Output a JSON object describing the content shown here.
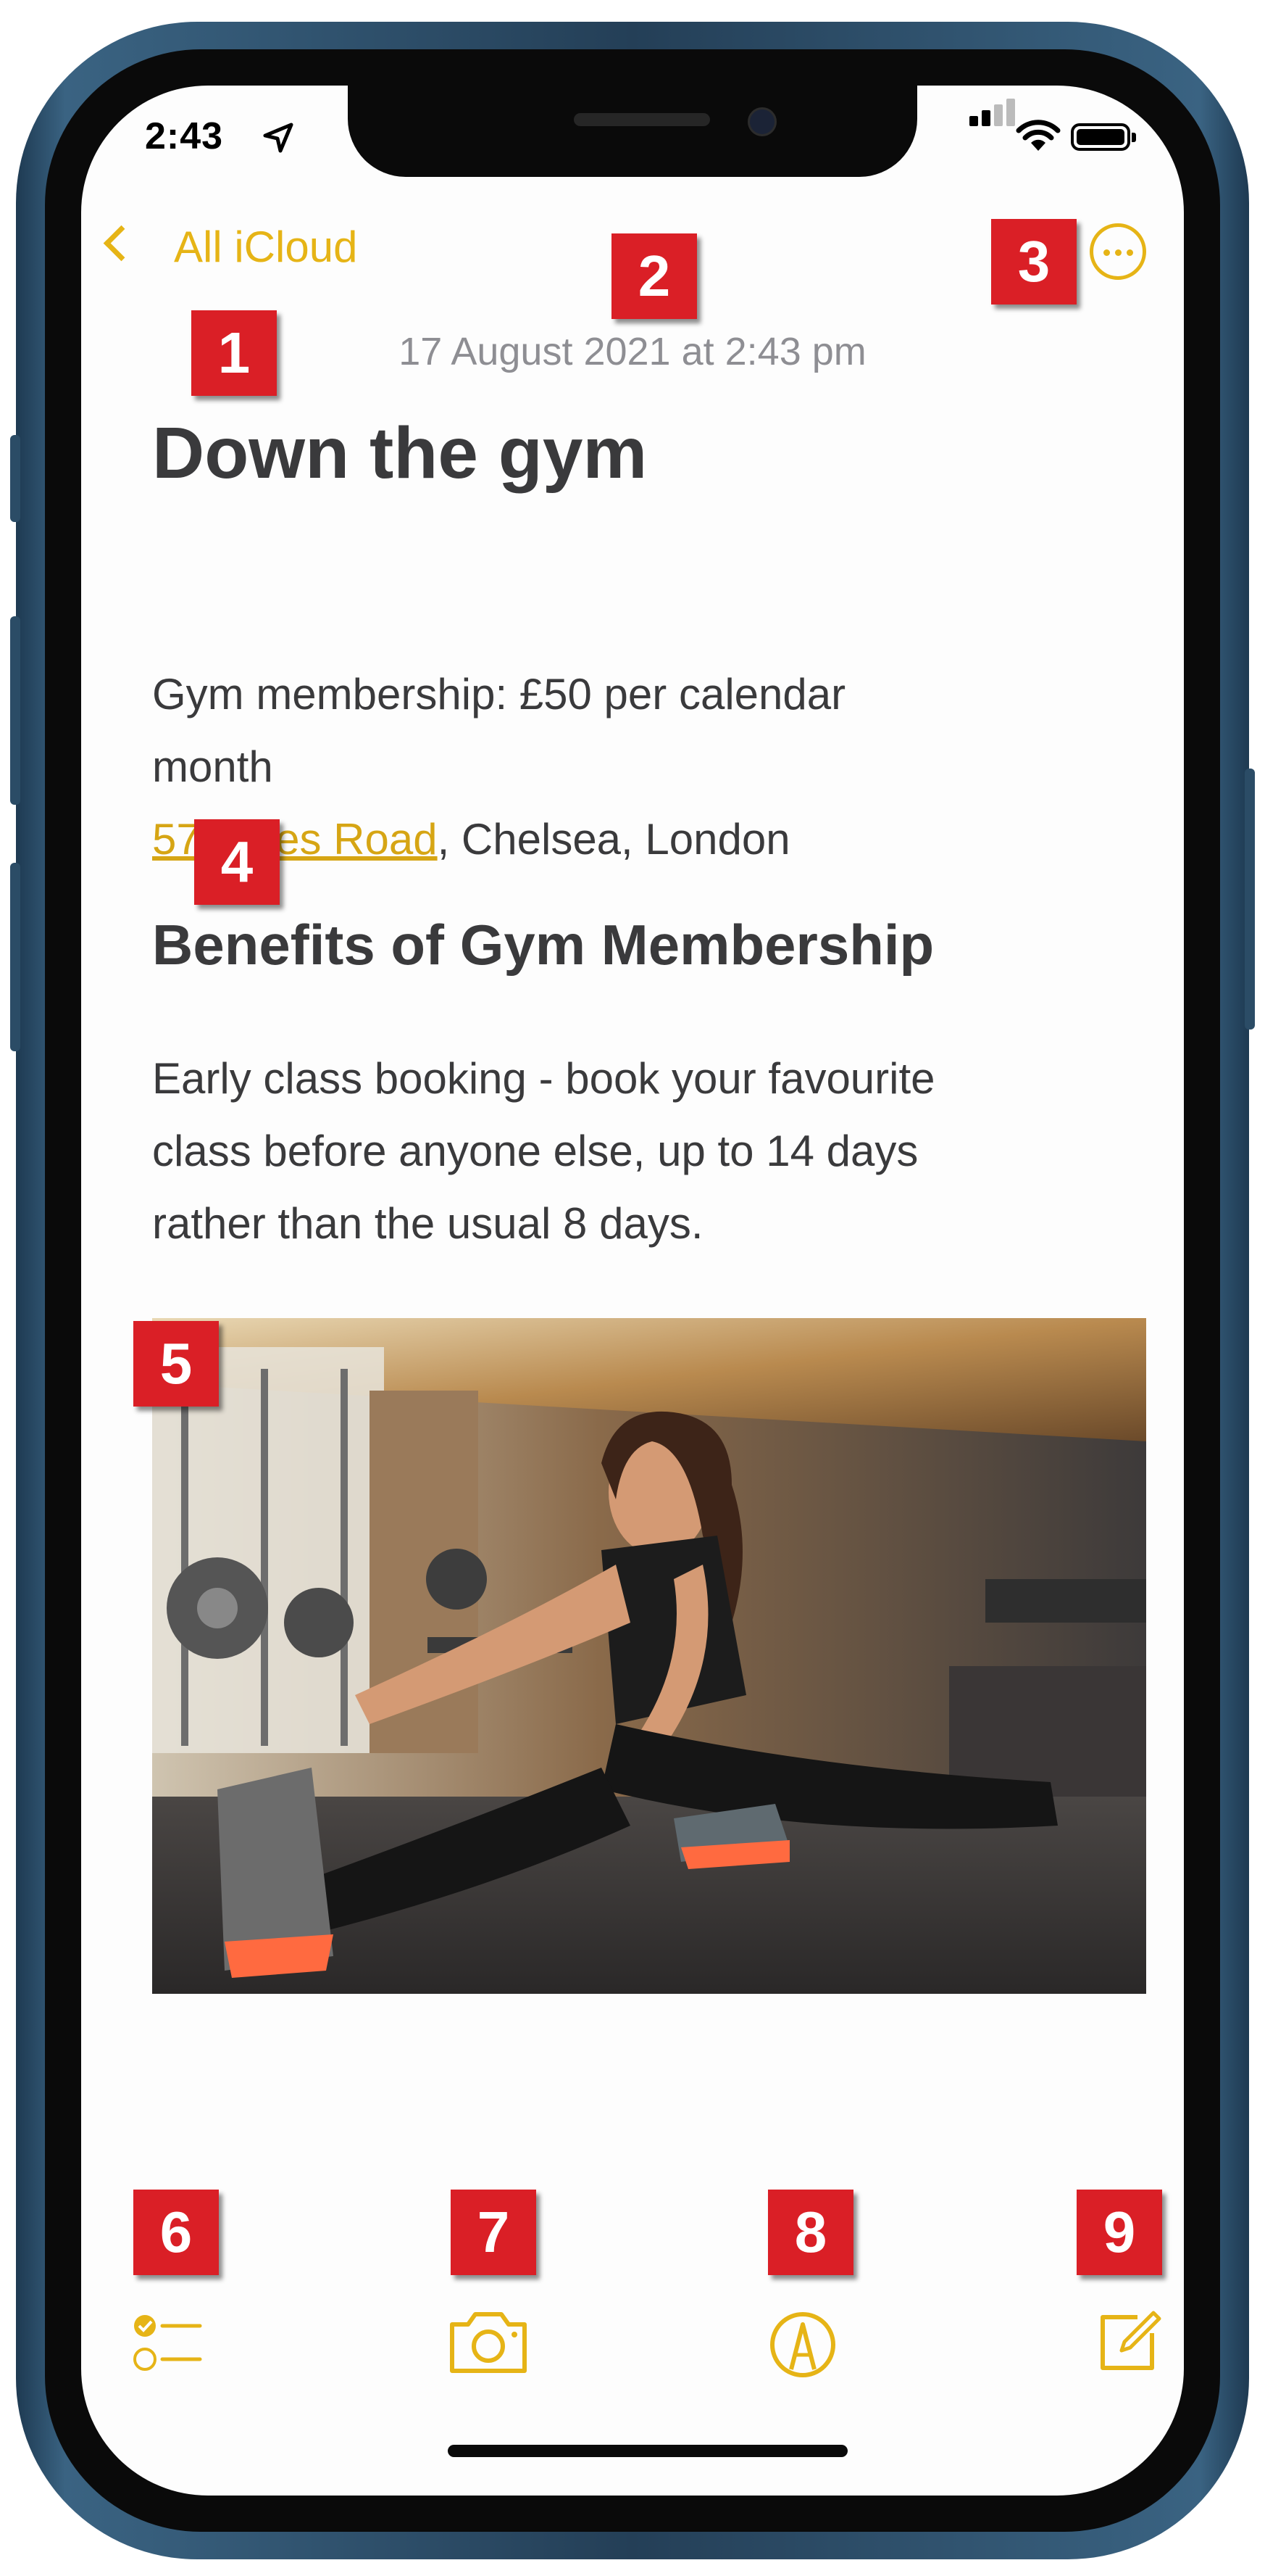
{
  "status_bar": {
    "time": "2:43"
  },
  "nav": {
    "back_label": "All iCloud"
  },
  "note": {
    "date": "17 August 2021 at 2:43 pm",
    "title": "Down the gym",
    "membership_line1": "Gym membership: £50 per calendar",
    "membership_line2": "month",
    "address_link": "57 Arkes Road",
    "address_rest": ", Chelsea, London",
    "section_heading": "Benefits of  Gym Membership",
    "benefit_line1": "Early class booking - book your favourite",
    "benefit_line2": "class before anyone else, up to 14 days",
    "benefit_line3": "rather than the usual 8 days."
  },
  "callouts": [
    "1",
    "2",
    "3",
    "4",
    "5",
    "6",
    "7",
    "8",
    "9"
  ],
  "accent_color": "#e6b416",
  "callout_color": "#da1f26",
  "icons": {
    "more": "ellipsis-circle-icon",
    "checklist": "checklist-icon",
    "camera": "camera-icon",
    "markup": "markup-pen-icon",
    "compose": "compose-icon"
  }
}
